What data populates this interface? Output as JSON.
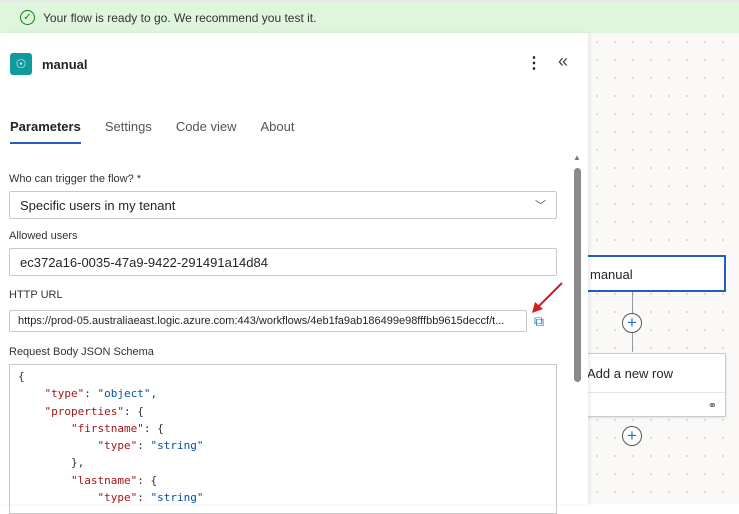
{
  "banner": {
    "message": "Your flow is ready to go. We recommend you test it."
  },
  "panel": {
    "title": "manual",
    "tabs": [
      "Parameters",
      "Settings",
      "Code view",
      "About"
    ]
  },
  "params": {
    "who_label": "Who can trigger the flow? *",
    "who_value": "Specific users in my tenant",
    "allowed_label": "Allowed users",
    "allowed_value": "ec372a16-0035-47a9-9422-291491a14d84",
    "url_label": "HTTP URL",
    "url_value": "https://prod-05.australiaeast.logic.azure.com:443/workflows/4eb1fa9ab186499e98fffbb9615deccf/t...",
    "schema_label": "Request Body JSON Schema",
    "schema_lines": [
      [
        [
          "p",
          "{"
        ]
      ],
      [
        [
          "p",
          "    "
        ],
        [
          "k",
          "\"type\""
        ],
        [
          "p",
          ": "
        ],
        [
          "s",
          "\"object\""
        ],
        [
          "p",
          ","
        ]
      ],
      [
        [
          "p",
          "    "
        ],
        [
          "k",
          "\"properties\""
        ],
        [
          "p",
          ": {"
        ]
      ],
      [
        [
          "p",
          "        "
        ],
        [
          "k",
          "\"firstname\""
        ],
        [
          "p",
          ": {"
        ]
      ],
      [
        [
          "p",
          "            "
        ],
        [
          "k",
          "\"type\""
        ],
        [
          "p",
          ": "
        ],
        [
          "s",
          "\"string\""
        ]
      ],
      [
        [
          "p",
          "        },"
        ]
      ],
      [
        [
          "p",
          "        "
        ],
        [
          "k",
          "\"lastname\""
        ],
        [
          "p",
          ": {"
        ]
      ],
      [
        [
          "p",
          "            "
        ],
        [
          "k",
          "\"type\""
        ],
        [
          "p",
          ": "
        ],
        [
          "s",
          "\"string\""
        ]
      ]
    ]
  },
  "canvas": {
    "node1": "manual",
    "node2": "Add a new row"
  }
}
